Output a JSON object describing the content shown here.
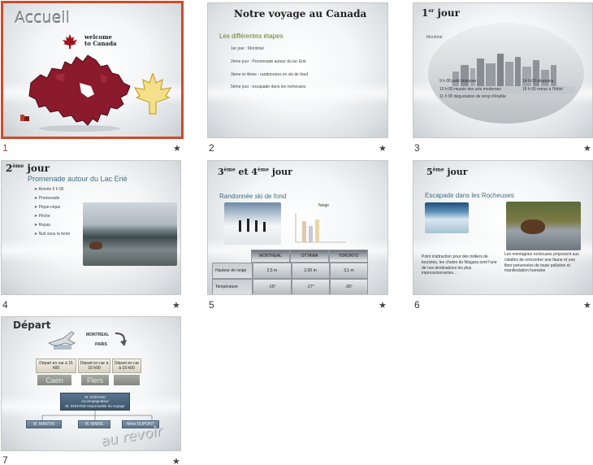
{
  "slides": [
    {
      "number": "1",
      "title": "Accueil",
      "welcome": "welcome\nto Canada"
    },
    {
      "number": "2",
      "title": "Notre voyage au Canada",
      "subtitle": "Les différentes étapes",
      "bullets": [
        "1er jour : Montréal",
        "2ème jour : Promenade autour du lac Erié",
        "3ème et 4ème : randonnées en ski de fond",
        "5ème jour : escapade dans les rocheuses"
      ]
    },
    {
      "number": "3",
      "title_main": "1",
      "title_sup": "er",
      "title_rest": " jour",
      "caption": "Montréal",
      "schedule_left": [
        "9 h 00 petit déjeuner",
        "10 h 00 musée des arts modernes",
        "11 h 00 dégustation de sirop d'érable"
      ],
      "schedule_right": [
        "14 h 00 shopping",
        "18 h 00 retour à l'hôtel"
      ]
    },
    {
      "number": "4",
      "title_main": "2",
      "title_sup": "ème",
      "title_rest": " jour",
      "subtitle": "Promenade autour du Lac Erié",
      "bullets": [
        "Arrivée 9 h 00",
        "Promenade",
        "Pique-nique",
        "Pêche",
        "Repas",
        "Nuit sous la tente"
      ]
    },
    {
      "number": "5",
      "title_a": "3",
      "title_a_sup": "ème",
      "title_mid": " et 4",
      "title_b_sup": "ème",
      "title_rest": " jour",
      "subtitle": "Randonnée ski de fond",
      "chart_title": "Neige",
      "table": {
        "headers": [
          "",
          "MONTREAL",
          "OTTAWA",
          "TORONTO"
        ],
        "rows": [
          [
            "Hauteur de neige",
            "2,5 m",
            "2,00 m",
            "3,1 m"
          ],
          [
            "Température",
            "-15°",
            "-27°",
            "-35°"
          ]
        ]
      }
    },
    {
      "number": "6",
      "title_main": "5",
      "title_sup": "ème",
      "title_rest": " jour",
      "subtitle": "Escapade dans les Rocheuses",
      "text_left": "Point d'attraction pour des milliers de touristes, les chutes du Niagara sont l'une de nos destinations les plus impressionnantes…",
      "text_right": "Les montagnes rocheuses proposent aux citadins de rencontrer une faune et une flore préservées de toute pollution et manifestation humaine"
    },
    {
      "number": "7",
      "title": "Départ",
      "route": [
        "MONTREAL",
        "PARIS"
      ],
      "departures": [
        "Départ en car à 16 h00",
        "Départ en car à 16 h00",
        "Départ en car à 16 h00"
      ],
      "cities": [
        "Caen",
        "Flers",
        ""
      ],
      "manager": "M. DURAND\nAccompagnateur\nM. DURAND responsable du voyage",
      "staff": [
        "M. MARTIN",
        "M. MARIE",
        "Mme DUPONT"
      ],
      "farewell": "au revoir"
    }
  ],
  "star_symbol": "★",
  "colors": {
    "selection": "#d04a2a",
    "canada_red": "#8b1a2c",
    "title_green": "#6b7a2a"
  }
}
